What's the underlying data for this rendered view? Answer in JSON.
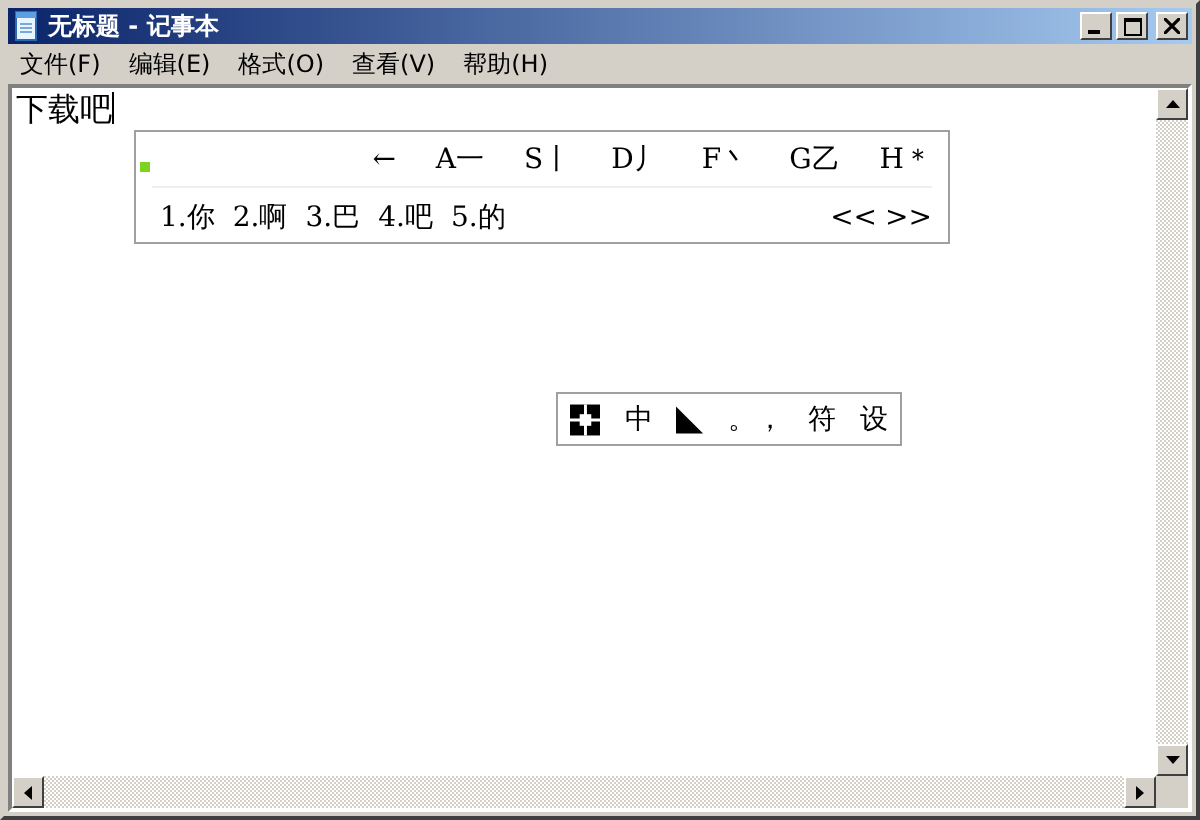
{
  "window": {
    "title": "无标题 - 记事本"
  },
  "menu": [
    {
      "label": "文件(F)"
    },
    {
      "label": "编辑(E)"
    },
    {
      "label": "格式(O)"
    },
    {
      "label": "查看(V)"
    },
    {
      "label": "帮助(H)"
    }
  ],
  "document": {
    "text": "下载吧"
  },
  "ime_candidates": {
    "strokes": [
      "←",
      "A一",
      "S丨",
      "D丿",
      "F丶",
      "G乙",
      "H＊"
    ],
    "candidates": [
      "1.你",
      "2.啊",
      "3.巴",
      "4.吧",
      "5.的"
    ],
    "paging": [
      "<<",
      ">>"
    ]
  },
  "ime_status": {
    "mode": "中",
    "punctuation": "。，",
    "symbols": "符",
    "settings": "设"
  }
}
